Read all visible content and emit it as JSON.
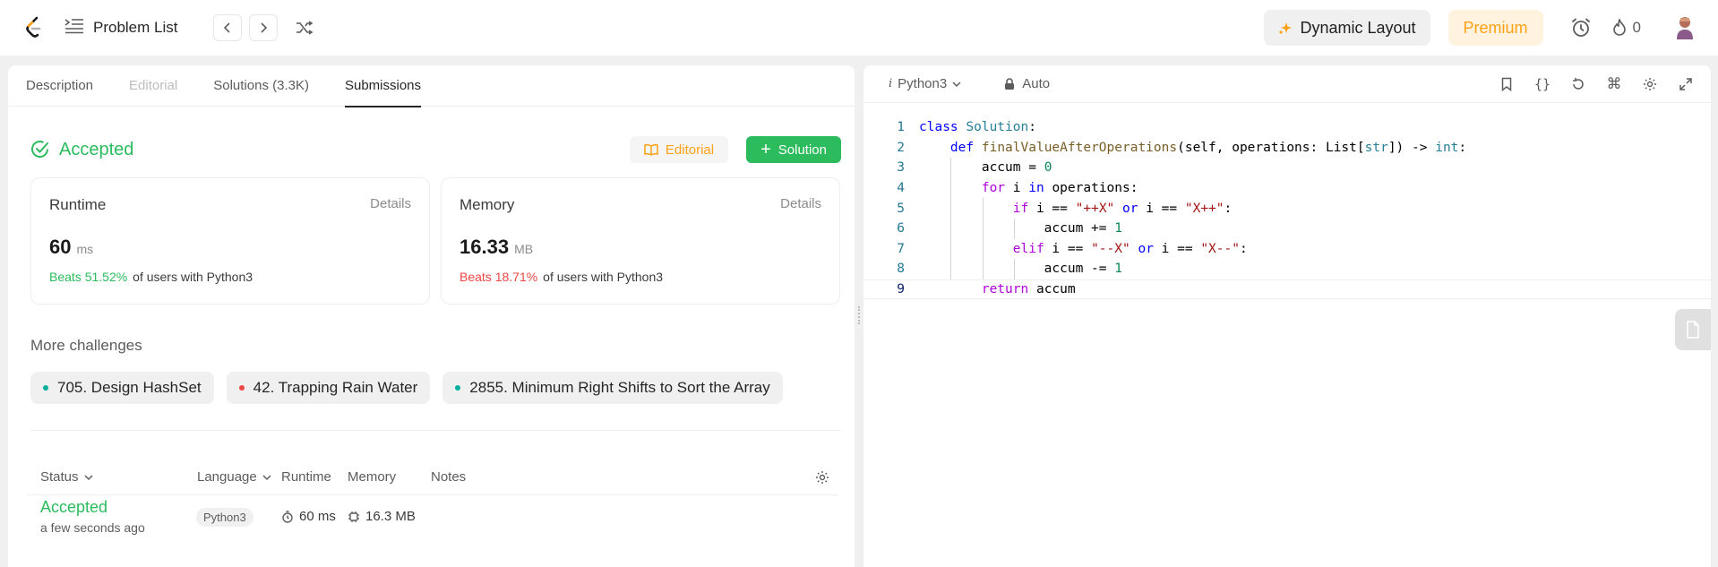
{
  "topbar": {
    "problem_list": "Problem List",
    "dynamic_layout": "Dynamic Layout",
    "premium": "Premium",
    "streak_count": "0"
  },
  "left_tabs": [
    {
      "label": "Description"
    },
    {
      "label": "Editorial"
    },
    {
      "label": "Solutions (3.3K)"
    },
    {
      "label": "Submissions"
    }
  ],
  "result": {
    "status": "Accepted",
    "editorial_btn": "Editorial",
    "solution_btn": "Solution"
  },
  "runtime_card": {
    "title": "Runtime",
    "details": "Details",
    "value": "60",
    "unit": "ms",
    "beats": "Beats 51.52%",
    "beats_suffix": "of users with Python3"
  },
  "memory_card": {
    "title": "Memory",
    "details": "Details",
    "value": "16.33",
    "unit": "MB",
    "beats": "Beats 18.71%",
    "beats_suffix": "of users with Python3"
  },
  "challenges": {
    "title": "More challenges",
    "items": [
      {
        "label": "705. Design HashSet",
        "dot_color": "#00af9b"
      },
      {
        "label": "42. Trapping Rain Water",
        "dot_color": "#ef4743"
      },
      {
        "label": "2855. Minimum Right Shifts to Sort the Array",
        "dot_color": "#00af9b"
      }
    ]
  },
  "table": {
    "headers": {
      "status": "Status",
      "language": "Language",
      "runtime": "Runtime",
      "memory": "Memory",
      "notes": "Notes"
    },
    "row": {
      "status": "Accepted",
      "time": "a few seconds ago",
      "language": "Python3",
      "runtime": "60 ms",
      "memory": "16.3 MB"
    }
  },
  "editor": {
    "language": "Python3",
    "mode": "Auto",
    "line_numbers": [
      "1",
      "2",
      "3",
      "4",
      "5",
      "6",
      "7",
      "8",
      "9"
    ]
  },
  "colors": {
    "accent_green": "#2cbb5d",
    "accent_orange": "#ffa116",
    "danger_red": "#ef4743"
  }
}
